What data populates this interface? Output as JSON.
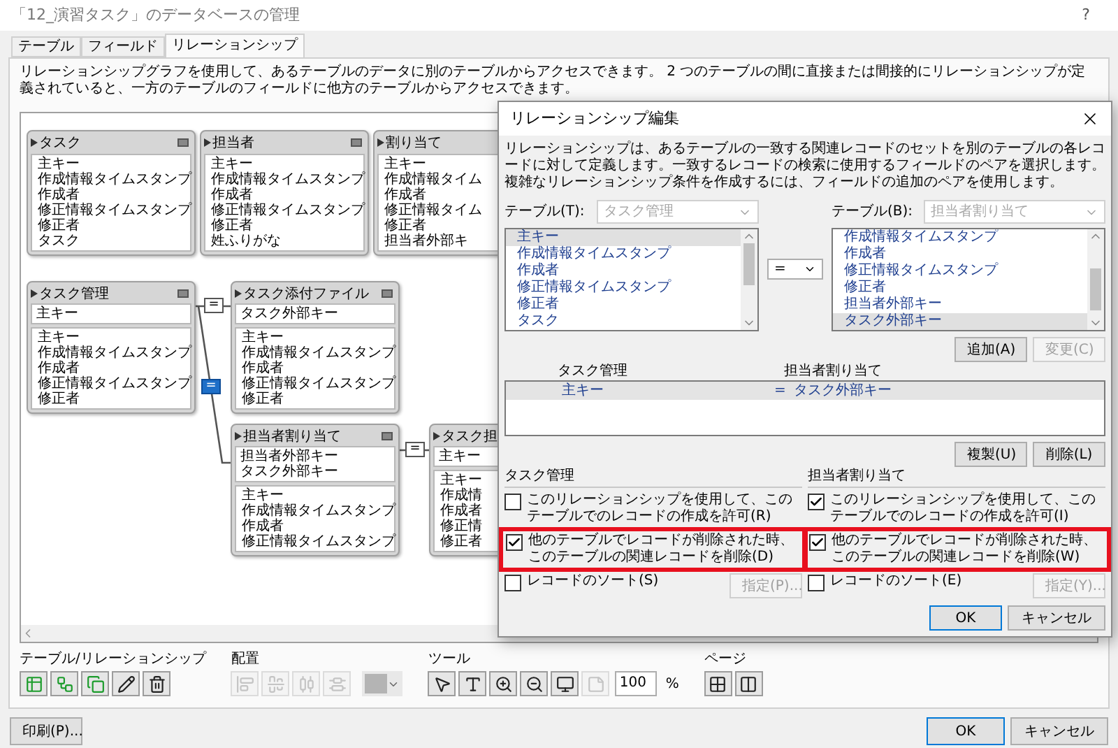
{
  "window": {
    "title": "「12_演習タスク」のデータベースの管理",
    "help": "?"
  },
  "tabs": [
    {
      "label": "テーブル",
      "selected": false
    },
    {
      "label": "フィールド",
      "selected": false
    },
    {
      "label": "リレーションシップ",
      "selected": true
    }
  ],
  "description": "リレーションシップグラフを使用して、あるテーブルのデータに別のテーブルからアクセスできます。 2 つのテーブルの間に直接または間接的にリレーションシップが定義されていると、一方のテーブルのフィールドに他方のテーブルからアクセスできます。",
  "graph": {
    "tables": [
      {
        "name": "タスク",
        "fields": [
          "主キー",
          "作成情報タイムスタンプ",
          "作成者",
          "修正情報タイムスタンプ",
          "修正者",
          "タスク"
        ]
      },
      {
        "name": "担当者",
        "fields": [
          "主キー",
          "作成情報タイムスタンプ",
          "作成者",
          "修正情報タイムスタンプ",
          "修正者",
          "姓ふりがな"
        ]
      },
      {
        "name": "割り当て",
        "fields": [
          "主キー",
          "作成情報タイム",
          "作成者",
          "修正情報タイム",
          "修正者",
          "担当者外部キ"
        ]
      },
      {
        "name": "タスク管理",
        "keys": [
          "主キー"
        ],
        "fields": [
          "主キー",
          "作成情報タイムスタンプ",
          "作成者",
          "修正情報タイムスタンプ",
          "修正者"
        ]
      },
      {
        "name": "タスク添付ファイル",
        "keys": [
          "タスク外部キー"
        ],
        "fields": [
          "主キー",
          "作成情報タイムスタンプ",
          "作成者",
          "修正情報タイムスタンプ",
          "修正者"
        ]
      },
      {
        "name": "担当者割り当て",
        "keys": [
          "担当者外部キー",
          "タスク外部キー"
        ],
        "fields": [
          "主キー",
          "作成情報タイムスタンプ",
          "作成者",
          "修正情報タイムスタンプ"
        ]
      },
      {
        "name": "タスク担",
        "keys": [
          "主キー"
        ],
        "fields": [
          "主キー",
          "作成情",
          "作成者",
          "修正情",
          "修正者"
        ]
      }
    ],
    "relationships": [
      {
        "operator": "=",
        "selected": false
      },
      {
        "operator": "=",
        "selected": true
      },
      {
        "operator": "=",
        "selected": false
      }
    ]
  },
  "toolbar": {
    "groups": [
      {
        "label": "テーブル/リレーションシップ",
        "buttons": [
          {
            "disabled": false
          },
          {
            "disabled": false
          },
          {
            "disabled": false
          },
          {
            "disabled": false
          },
          {
            "disabled": false
          }
        ]
      },
      {
        "label": "配置",
        "buttons": [
          {
            "disabled": true
          },
          {
            "disabled": true
          },
          {
            "disabled": true
          },
          {
            "disabled": true
          }
        ]
      },
      {
        "label": "ツール",
        "buttons": [
          {
            "disabled": false
          },
          {
            "disabled": false
          },
          {
            "disabled": false
          },
          {
            "disabled": false
          },
          {
            "disabled": false
          },
          {
            "disabled": true
          }
        ]
      },
      {
        "label": "ページ",
        "buttons": [
          {
            "disabled": false
          },
          {
            "disabled": false
          }
        ]
      }
    ],
    "zoom": "100",
    "zoom_unit": "%"
  },
  "buttons": {
    "print": "印刷(P)...",
    "ok": "OK",
    "cancel": "キャンセル"
  },
  "dialog": {
    "title": "リレーションシップ編集",
    "description": "リレーションシップは、あるテーブルの一致する関連レコードのセットを別のテーブルの各レコードに対して定義します。一致するレコードの検索に使用するフィールドのペアを選択します。複雑なリレーションシップ条件を作成するには、フィールドの追加のペアを使用します。",
    "left": {
      "label": "テーブル(T):",
      "table": "タスク管理",
      "disabled": true,
      "fields": [
        {
          "name": "主キー",
          "selected": true
        },
        {
          "name": "作成情報タイムスタンプ",
          "selected": false
        },
        {
          "name": "作成者",
          "selected": false
        },
        {
          "name": "修正情報タイムスタンプ",
          "selected": false
        },
        {
          "name": "修正者",
          "selected": false
        },
        {
          "name": "タスク",
          "selected": false
        }
      ]
    },
    "operator": "=",
    "right": {
      "label": "テーブル(B):",
      "table": "担当者割り当て",
      "disabled": true,
      "fields": [
        {
          "name": "作成情報タイムスタンプ",
          "selected": false
        },
        {
          "name": "作成者",
          "selected": false
        },
        {
          "name": "修正情報タイムスタンプ",
          "selected": false
        },
        {
          "name": "修正者",
          "selected": false
        },
        {
          "name": "担当者外部キー",
          "selected": false
        },
        {
          "name": "タスク外部キー",
          "selected": true
        }
      ]
    },
    "add": {
      "label": "追加(A)",
      "disabled": false
    },
    "change": {
      "label": "変更(C)",
      "disabled": true
    },
    "pair_headers": [
      "タスク管理",
      "担当者割り当て"
    ],
    "pairs": [
      {
        "left": "主キー",
        "operator": "=",
        "right": "タスク外部キー",
        "selected": true
      }
    ],
    "duplicate": {
      "label": "複製(U)",
      "disabled": false
    },
    "delete": {
      "label": "削除(L)",
      "disabled": false
    },
    "sections": [
      {
        "table": "タスク管理",
        "options": [
          {
            "label": "このリレーションシップを使用して、このテーブルでのレコードの作成を許可(R)",
            "checked": false,
            "highlighted": false
          },
          {
            "label": "他のテーブルでレコードが削除された時、このテーブルの関連レコードを削除(D)",
            "checked": true,
            "highlighted": true
          },
          {
            "label": "レコードのソート(S)",
            "checked": false,
            "highlighted": false
          }
        ],
        "specify": {
          "label": "指定(P)...",
          "disabled": true
        }
      },
      {
        "table": "担当者割り当て",
        "options": [
          {
            "label": "このリレーションシップを使用して、このテーブルでのレコードの作成を許可(I)",
            "checked": true,
            "highlighted": false
          },
          {
            "label": "他のテーブルでレコードが削除された時、このテーブルの関連レコードを削除(W)",
            "checked": true,
            "highlighted": true
          },
          {
            "label": "レコードのソート(E)",
            "checked": false,
            "highlighted": false
          }
        ],
        "specify": {
          "label": "指定(Y)...",
          "disabled": true
        }
      }
    ],
    "ok": "OK",
    "cancel": "キャンセル"
  }
}
